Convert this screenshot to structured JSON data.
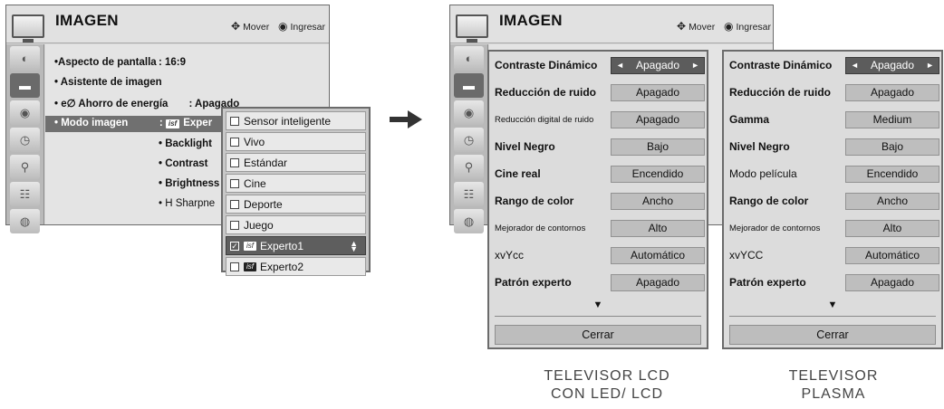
{
  "left_menu": {
    "title": "IMAGEN",
    "hint_move": "Mover",
    "hint_enter": "Ingresar",
    "sidebar_icons": [
      "satellite-dish-icon",
      "picture-icon",
      "speaker-icon",
      "clock-icon",
      "lock-icon",
      "options-icon",
      "network-icon"
    ],
    "rows": [
      {
        "text": "•Aspecto de pantalla : 16:9"
      },
      {
        "text": "• Asistente de imagen"
      },
      {
        "text": "• e∅ Ahorro de energía  : Apagado"
      },
      {
        "text": "• Modo imagen   : "
      },
      {
        "text": "• Backlight"
      },
      {
        "text": "• Contrast"
      },
      {
        "text": "• Brightness"
      },
      {
        "text": "• H Sharpne"
      }
    ],
    "mode_value_badge": "isf",
    "mode_value_text": "Exper"
  },
  "dropdown": {
    "items": [
      {
        "label": "Sensor inteligente",
        "checked": false,
        "isf": false
      },
      {
        "label": "Vivo",
        "checked": false,
        "isf": false
      },
      {
        "label": "Estándar",
        "checked": false,
        "isf": false
      },
      {
        "label": "Cine",
        "checked": false,
        "isf": false
      },
      {
        "label": "Deporte",
        "checked": false,
        "isf": false
      },
      {
        "label": "Juego",
        "checked": false,
        "isf": false
      },
      {
        "label": "Experto1",
        "checked": true,
        "isf": true
      },
      {
        "label": "Experto2",
        "checked": false,
        "isf": true
      }
    ],
    "isf_badge": "isf"
  },
  "right_menu": {
    "title": "IMAGEN",
    "hint_move": "Mover",
    "hint_enter": "Ingresar"
  },
  "lcd_panel": {
    "rows": [
      {
        "label": "Contraste Dinámico",
        "value": "Apagado",
        "small": false
      },
      {
        "label": "Reducción de ruido",
        "value": "Apagado",
        "small": false
      },
      {
        "label": "Reducción digital de ruido",
        "value": "Apagado",
        "small": true
      },
      {
        "label": "Nivel Negro",
        "value": "Bajo",
        "small": false
      },
      {
        "label": "Cine real",
        "value": "Encendido",
        "small": false
      },
      {
        "label": "Rango de color",
        "value": "Ancho",
        "small": false
      },
      {
        "label": "Mejorador de contornos",
        "value": "Alto",
        "small": true
      },
      {
        "label": "xvYcc",
        "value": "Automático",
        "small": false
      },
      {
        "label": "Patrón experto",
        "value": "Apagado",
        "small": false
      }
    ],
    "close_label": "Cerrar",
    "caption_line1": "TELEVISOR LCD",
    "caption_line2": "CON LED/ LCD"
  },
  "plasma_panel": {
    "rows": [
      {
        "label": "Contraste Dinámico",
        "value": "Apagado",
        "small": false
      },
      {
        "label": "Reducción de ruido",
        "value": "Apagado",
        "small": false
      },
      {
        "label": "Gamma",
        "value": "Medium",
        "small": false
      },
      {
        "label": "Nivel Negro",
        "value": "Bajo",
        "small": false
      },
      {
        "label": "Modo película",
        "value": "Encendido",
        "small": false
      },
      {
        "label": "Rango de color",
        "value": "Ancho",
        "small": false
      },
      {
        "label": "Mejorador de contornos",
        "value": "Alto",
        "small": true
      },
      {
        "label": "xvYCC",
        "value": "Automático",
        "small": false
      },
      {
        "label": "Patrón experto",
        "value": "Apagado",
        "small": false
      }
    ],
    "close_label": "Cerrar",
    "caption_line1": "TELEVISOR",
    "caption_line2": "PLASMA"
  }
}
